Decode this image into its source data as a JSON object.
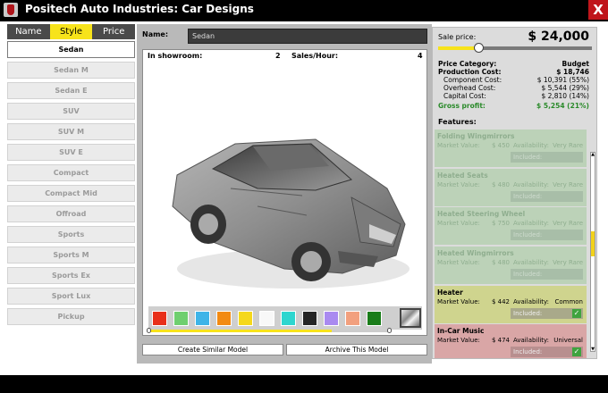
{
  "window": {
    "title": "Positech Auto Industries: Car Designs",
    "close_label": "X"
  },
  "tabs": [
    {
      "label": "Name"
    },
    {
      "label": "Style"
    },
    {
      "label": "Price"
    }
  ],
  "models": [
    {
      "label": "Sedan"
    },
    {
      "label": "Sedan M"
    },
    {
      "label": "Sedan E"
    },
    {
      "label": "SUV"
    },
    {
      "label": "SUV M"
    },
    {
      "label": "SUV E"
    },
    {
      "label": "Compact"
    },
    {
      "label": "Compact Mid"
    },
    {
      "label": "Offroad"
    },
    {
      "label": "Sports"
    },
    {
      "label": "Sports M"
    },
    {
      "label": "Sports Ex"
    },
    {
      "label": "Sport Lux"
    },
    {
      "label": "Pickup"
    }
  ],
  "design": {
    "name_label": "Name:",
    "name_value": "Sedan",
    "showroom_label": "In showroom:",
    "showroom_value": "2",
    "sales_label": "Sales/Hour:",
    "sales_value": "4"
  },
  "colors": {
    "swatches": [
      "#e8301a",
      "#6fcf6f",
      "#3eb4e8",
      "#f28a12",
      "#f5d81b",
      "#f8f8f8",
      "#2dd6cf",
      "#262626",
      "#a98af0",
      "#f2a07e",
      "#1a7d1a"
    ],
    "selected": "silver-metallic",
    "accent": "#f7e31b",
    "close_button": "#c0151b"
  },
  "color_slider_fraction": 0.76,
  "buttons": {
    "create_similar": "Create Similar Model",
    "archive": "Archive This Model"
  },
  "pricing": {
    "sale_label": "Sale price:",
    "sale_price": "$ 24,000",
    "price_slider_fraction": 0.26,
    "category_label": "Price Category:",
    "category_value": "Budget",
    "production_label": "Production Cost:",
    "production_value": "$ 18,746",
    "component_label": "Component Cost:",
    "component_value": "$ 10,391 (55%)",
    "overhead_label": "Overhead Cost:",
    "overhead_value": "$ 5,544 (29%)",
    "capital_label": "Capital Cost:",
    "capital_value": "$ 2,810 (14%)",
    "profit_label": "Gross profit:",
    "profit_value": "$ 5,254 (21%)"
  },
  "features_heading": "Features:",
  "features": [
    {
      "name": "Folding Wingmirrors",
      "mv_label": "Market Value:",
      "price": "$ 450",
      "av_label": "Availability:",
      "availability": "Very Rare",
      "included_label": "Included:",
      "included": false
    },
    {
      "name": "Heated Seats",
      "mv_label": "Market Value:",
      "price": "$ 480",
      "av_label": "Availability:",
      "availability": "Very Rare",
      "included_label": "Included:",
      "included": false
    },
    {
      "name": "Heated Steering Wheel",
      "mv_label": "Market Value:",
      "price": "$ 750",
      "av_label": "Availability:",
      "availability": "Very Rare",
      "included_label": "Included:",
      "included": false
    },
    {
      "name": "Heated Wingmirrors",
      "mv_label": "Market Value:",
      "price": "$ 480",
      "av_label": "Availability:",
      "availability": "Very Rare",
      "included_label": "Included:",
      "included": false
    },
    {
      "name": "Heater",
      "mv_label": "Market Value:",
      "price": "$ 442",
      "av_label": "Availability:",
      "availability": "Common",
      "included_label": "Included:",
      "included": true
    },
    {
      "name": "In-Car Music",
      "mv_label": "Market Value:",
      "price": "$ 474",
      "av_label": "Availability:",
      "availability": "Universal",
      "included_label": "Included:",
      "included": true
    }
  ]
}
